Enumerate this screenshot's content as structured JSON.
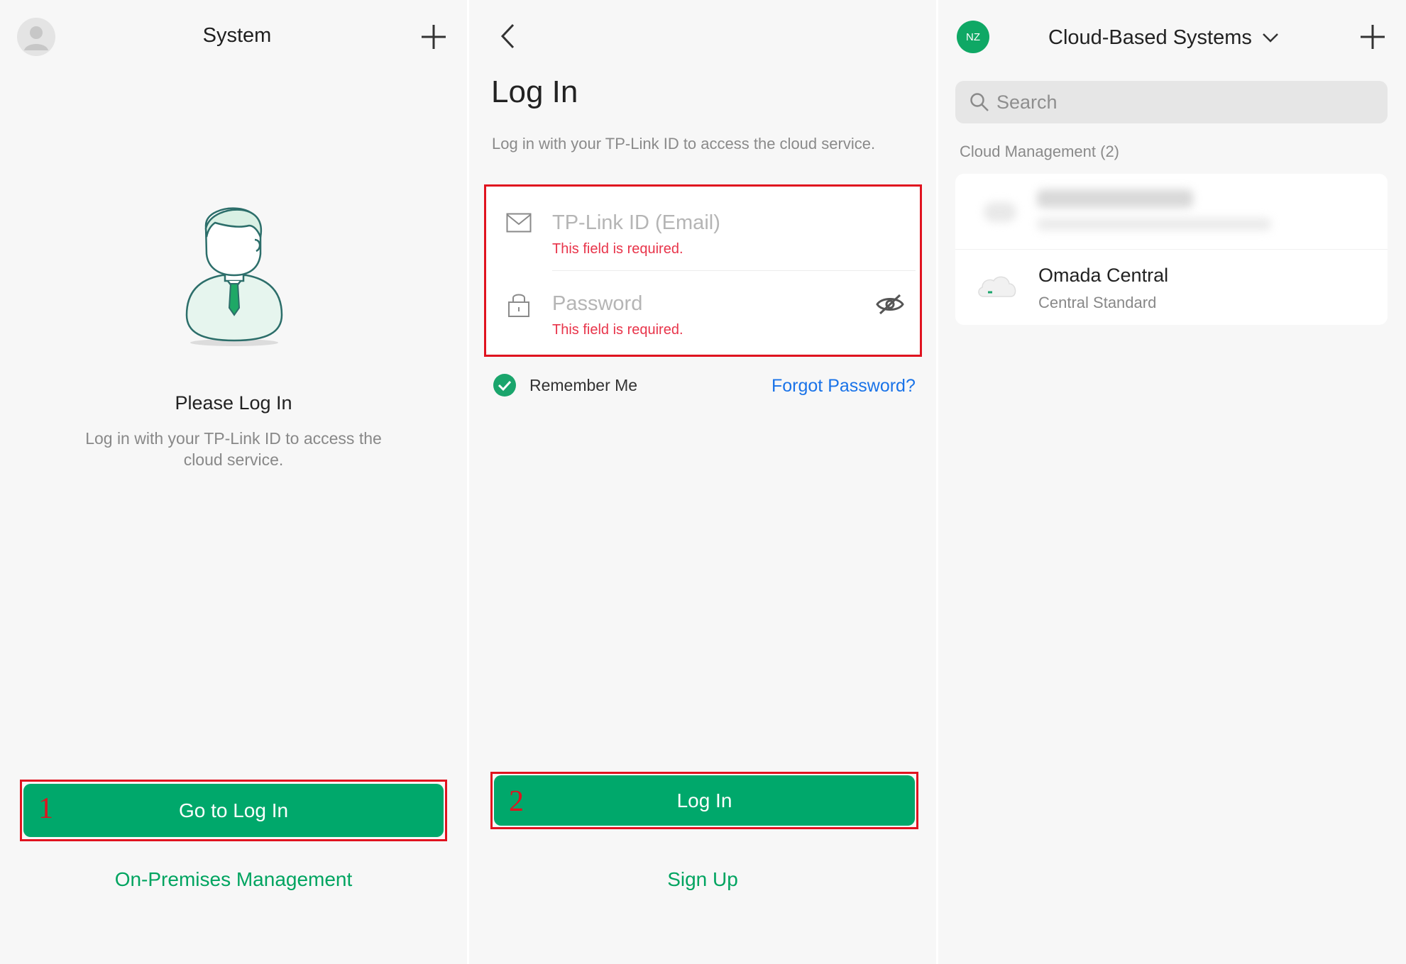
{
  "panel1": {
    "title": "System",
    "heading": "Please Log In",
    "description": "Log in with your TP-Link ID to access the cloud service.",
    "primary_button": "Go to Log In",
    "secondary_link": "On-Premises Management",
    "step_marker": "1"
  },
  "panel2": {
    "title": "Log In",
    "subtitle": "Log in with your TP-Link ID to access the cloud service.",
    "email_placeholder": "TP-Link ID (Email)",
    "email_error": "This field is required.",
    "password_placeholder": "Password",
    "password_error": "This field is required.",
    "remember_me": "Remember Me",
    "remember_me_checked": true,
    "forgot_password": "Forgot Password?",
    "login_button": "Log In",
    "sign_up": "Sign Up",
    "step_marker": "2"
  },
  "panel3": {
    "avatar_initials": "NZ",
    "title": "Cloud-Based Systems",
    "search_placeholder": "Search",
    "section_label": "Cloud Management (2)",
    "item": {
      "name": "Omada Central",
      "plan": "Central Standard"
    }
  },
  "colors": {
    "brand_green": "#00a86b",
    "highlight_red": "#e0131f",
    "error_red": "#e8344a",
    "link_blue": "#1a73e8",
    "panel_bg": "#f7f7f7"
  },
  "icons": [
    "avatar-icon",
    "plus-icon",
    "back-chevron-icon",
    "mail-icon",
    "lock-icon",
    "eye-off-icon",
    "check-circle-icon",
    "chevron-down-icon",
    "search-icon",
    "cloud-icon"
  ]
}
